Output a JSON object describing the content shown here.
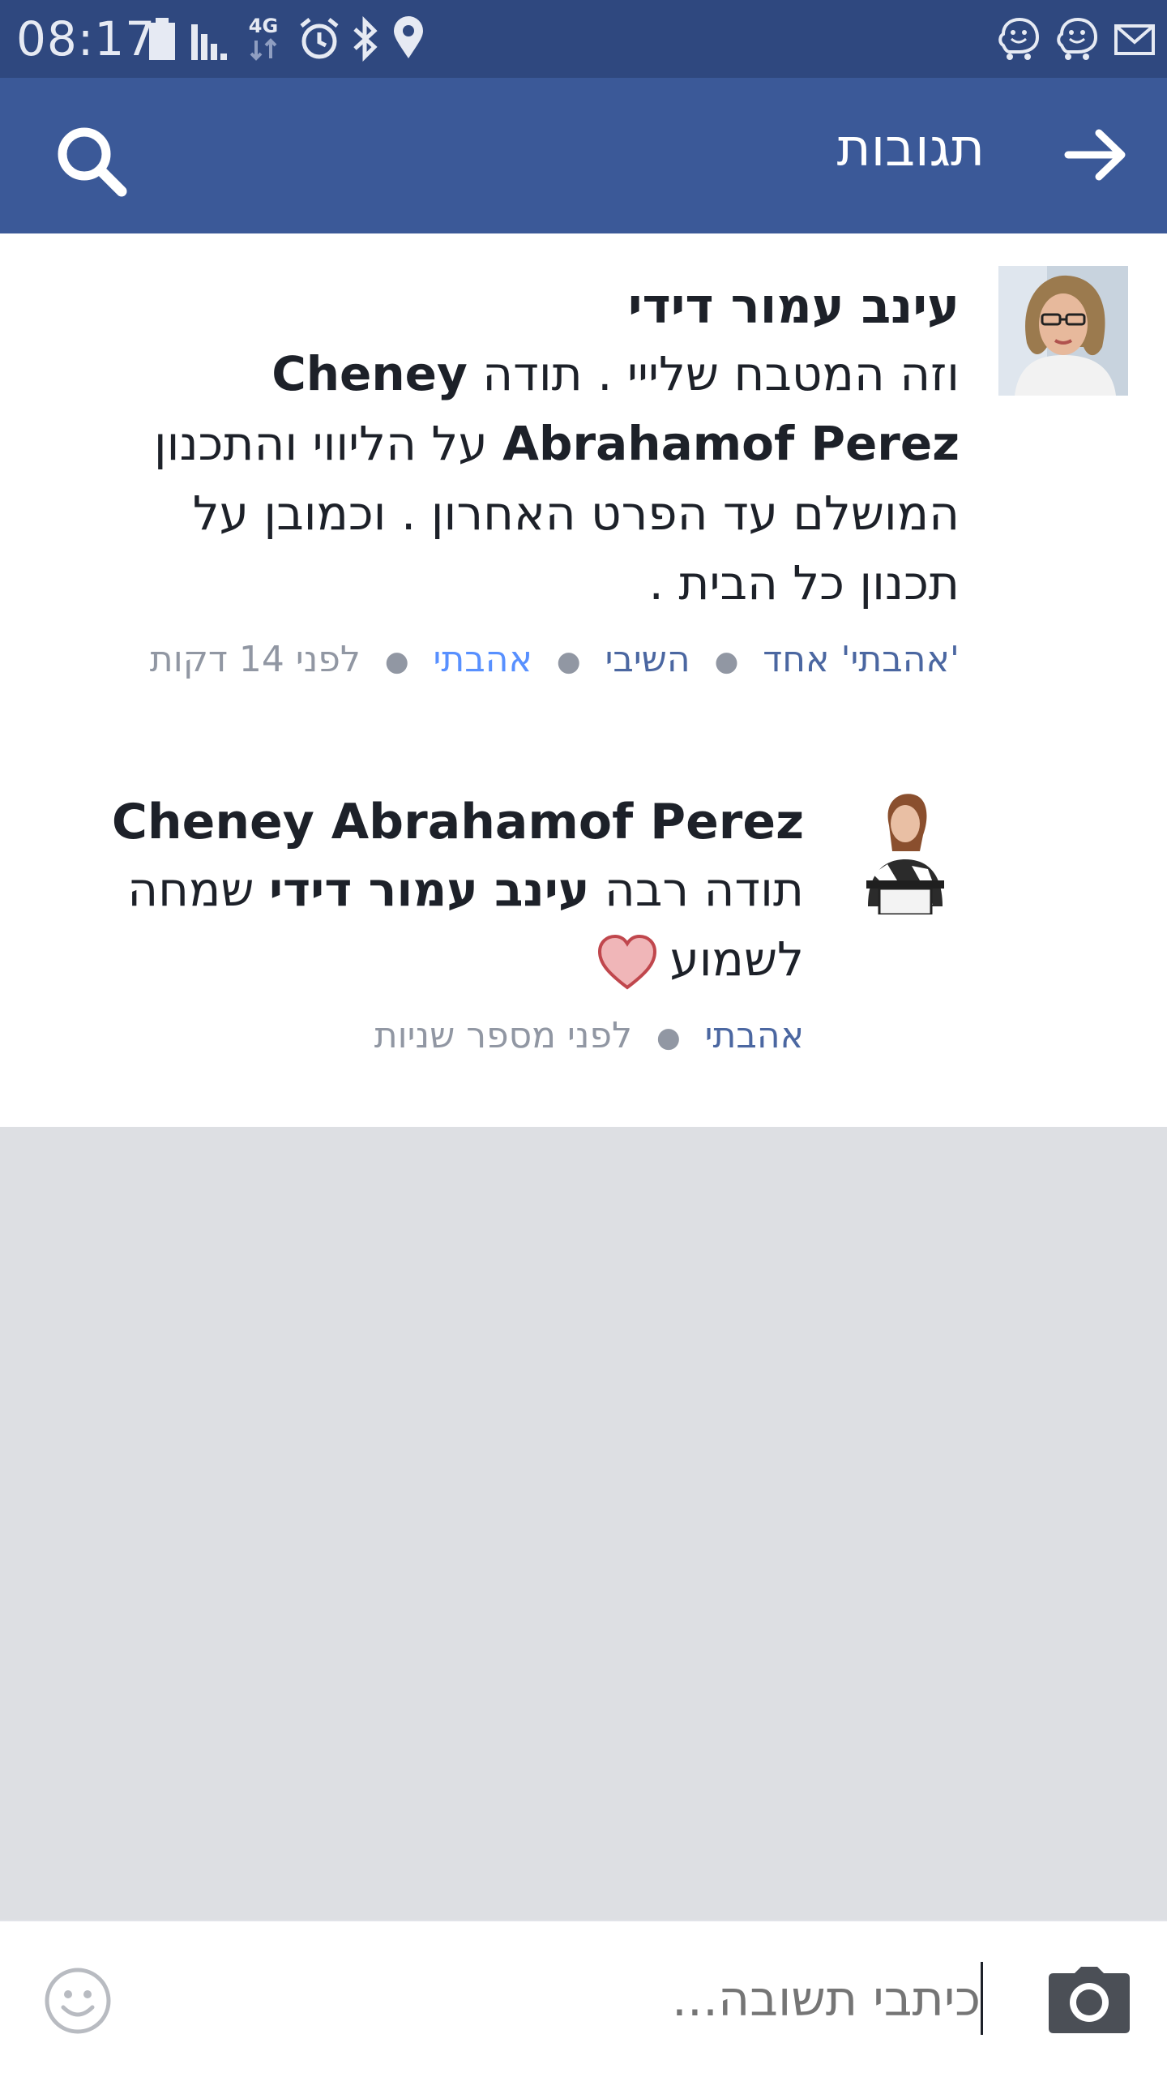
{
  "status_bar": {
    "time": "08:17",
    "network_label": "4G"
  },
  "header": {
    "title": "תגובות"
  },
  "comments": [
    {
      "author": "עינב עמור דידי",
      "text_parts": [
        "וזה המטבח שלייי . תודה ",
        "Cheney Abrahamof Perez",
        " על הליווי והתכנון המושלם עד הפרט האחרון . וכמובן על תכנון כל הבית ."
      ],
      "reactions_label": "'אהבתי' אחד",
      "reply_label": "השיבי",
      "like_label": "אהבתי",
      "time": "לפני 14 דקות"
    },
    {
      "author": "Cheney Abrahamof Perez",
      "text_parts": [
        "תודה רבה ",
        "עינב עמור דידי",
        " שמחה לשמוע"
      ],
      "like_label": "אהבתי",
      "time": "לפני מספר שניות"
    }
  ],
  "reply": {
    "placeholder": "כיתבי תשובה..."
  },
  "colors": {
    "status_bar": "#2f487f",
    "app_bar": "#3b5998",
    "link": "#4b67a1",
    "link_active": "#5890ff",
    "meta_text": "#9197a3",
    "empty_area": "#dddfe3"
  }
}
